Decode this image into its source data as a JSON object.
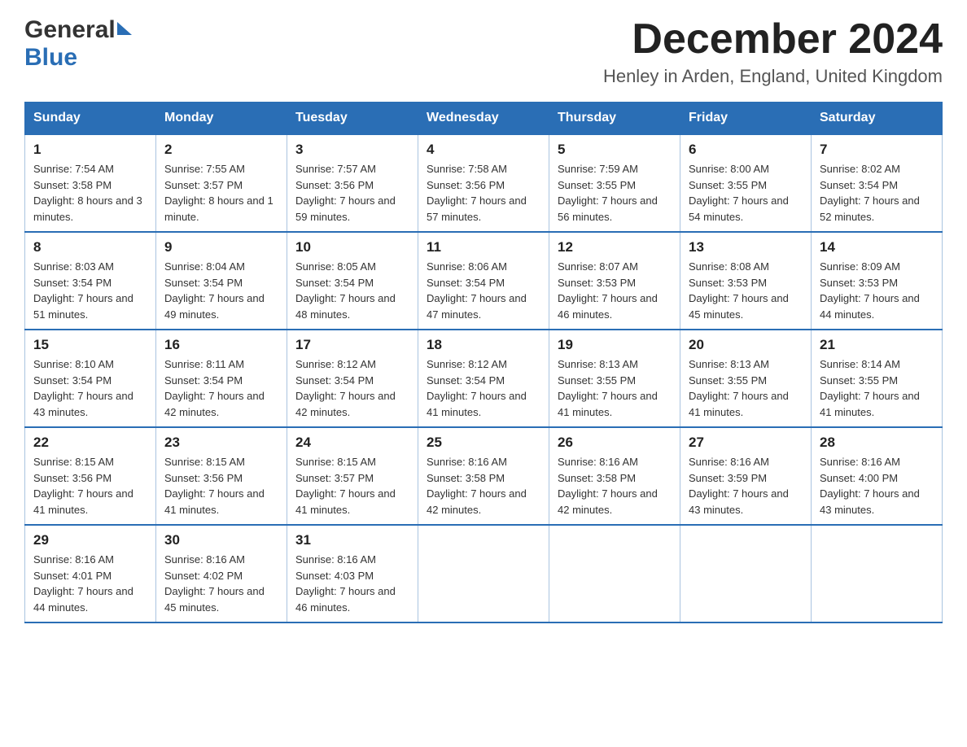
{
  "logo": {
    "general": "General",
    "blue": "Blue"
  },
  "title": "December 2024",
  "location": "Henley in Arden, England, United Kingdom",
  "days_of_week": [
    "Sunday",
    "Monday",
    "Tuesday",
    "Wednesday",
    "Thursday",
    "Friday",
    "Saturday"
  ],
  "weeks": [
    [
      {
        "day": "1",
        "sunrise": "7:54 AM",
        "sunset": "3:58 PM",
        "daylight": "8 hours and 3 minutes."
      },
      {
        "day": "2",
        "sunrise": "7:55 AM",
        "sunset": "3:57 PM",
        "daylight": "8 hours and 1 minute."
      },
      {
        "day": "3",
        "sunrise": "7:57 AM",
        "sunset": "3:56 PM",
        "daylight": "7 hours and 59 minutes."
      },
      {
        "day": "4",
        "sunrise": "7:58 AM",
        "sunset": "3:56 PM",
        "daylight": "7 hours and 57 minutes."
      },
      {
        "day": "5",
        "sunrise": "7:59 AM",
        "sunset": "3:55 PM",
        "daylight": "7 hours and 56 minutes."
      },
      {
        "day": "6",
        "sunrise": "8:00 AM",
        "sunset": "3:55 PM",
        "daylight": "7 hours and 54 minutes."
      },
      {
        "day": "7",
        "sunrise": "8:02 AM",
        "sunset": "3:54 PM",
        "daylight": "7 hours and 52 minutes."
      }
    ],
    [
      {
        "day": "8",
        "sunrise": "8:03 AM",
        "sunset": "3:54 PM",
        "daylight": "7 hours and 51 minutes."
      },
      {
        "day": "9",
        "sunrise": "8:04 AM",
        "sunset": "3:54 PM",
        "daylight": "7 hours and 49 minutes."
      },
      {
        "day": "10",
        "sunrise": "8:05 AM",
        "sunset": "3:54 PM",
        "daylight": "7 hours and 48 minutes."
      },
      {
        "day": "11",
        "sunrise": "8:06 AM",
        "sunset": "3:54 PM",
        "daylight": "7 hours and 47 minutes."
      },
      {
        "day": "12",
        "sunrise": "8:07 AM",
        "sunset": "3:53 PM",
        "daylight": "7 hours and 46 minutes."
      },
      {
        "day": "13",
        "sunrise": "8:08 AM",
        "sunset": "3:53 PM",
        "daylight": "7 hours and 45 minutes."
      },
      {
        "day": "14",
        "sunrise": "8:09 AM",
        "sunset": "3:53 PM",
        "daylight": "7 hours and 44 minutes."
      }
    ],
    [
      {
        "day": "15",
        "sunrise": "8:10 AM",
        "sunset": "3:54 PM",
        "daylight": "7 hours and 43 minutes."
      },
      {
        "day": "16",
        "sunrise": "8:11 AM",
        "sunset": "3:54 PM",
        "daylight": "7 hours and 42 minutes."
      },
      {
        "day": "17",
        "sunrise": "8:12 AM",
        "sunset": "3:54 PM",
        "daylight": "7 hours and 42 minutes."
      },
      {
        "day": "18",
        "sunrise": "8:12 AM",
        "sunset": "3:54 PM",
        "daylight": "7 hours and 41 minutes."
      },
      {
        "day": "19",
        "sunrise": "8:13 AM",
        "sunset": "3:55 PM",
        "daylight": "7 hours and 41 minutes."
      },
      {
        "day": "20",
        "sunrise": "8:13 AM",
        "sunset": "3:55 PM",
        "daylight": "7 hours and 41 minutes."
      },
      {
        "day": "21",
        "sunrise": "8:14 AM",
        "sunset": "3:55 PM",
        "daylight": "7 hours and 41 minutes."
      }
    ],
    [
      {
        "day": "22",
        "sunrise": "8:15 AM",
        "sunset": "3:56 PM",
        "daylight": "7 hours and 41 minutes."
      },
      {
        "day": "23",
        "sunrise": "8:15 AM",
        "sunset": "3:56 PM",
        "daylight": "7 hours and 41 minutes."
      },
      {
        "day": "24",
        "sunrise": "8:15 AM",
        "sunset": "3:57 PM",
        "daylight": "7 hours and 41 minutes."
      },
      {
        "day": "25",
        "sunrise": "8:16 AM",
        "sunset": "3:58 PM",
        "daylight": "7 hours and 42 minutes."
      },
      {
        "day": "26",
        "sunrise": "8:16 AM",
        "sunset": "3:58 PM",
        "daylight": "7 hours and 42 minutes."
      },
      {
        "day": "27",
        "sunrise": "8:16 AM",
        "sunset": "3:59 PM",
        "daylight": "7 hours and 43 minutes."
      },
      {
        "day": "28",
        "sunrise": "8:16 AM",
        "sunset": "4:00 PM",
        "daylight": "7 hours and 43 minutes."
      }
    ],
    [
      {
        "day": "29",
        "sunrise": "8:16 AM",
        "sunset": "4:01 PM",
        "daylight": "7 hours and 44 minutes."
      },
      {
        "day": "30",
        "sunrise": "8:16 AM",
        "sunset": "4:02 PM",
        "daylight": "7 hours and 45 minutes."
      },
      {
        "day": "31",
        "sunrise": "8:16 AM",
        "sunset": "4:03 PM",
        "daylight": "7 hours and 46 minutes."
      },
      null,
      null,
      null,
      null
    ]
  ]
}
